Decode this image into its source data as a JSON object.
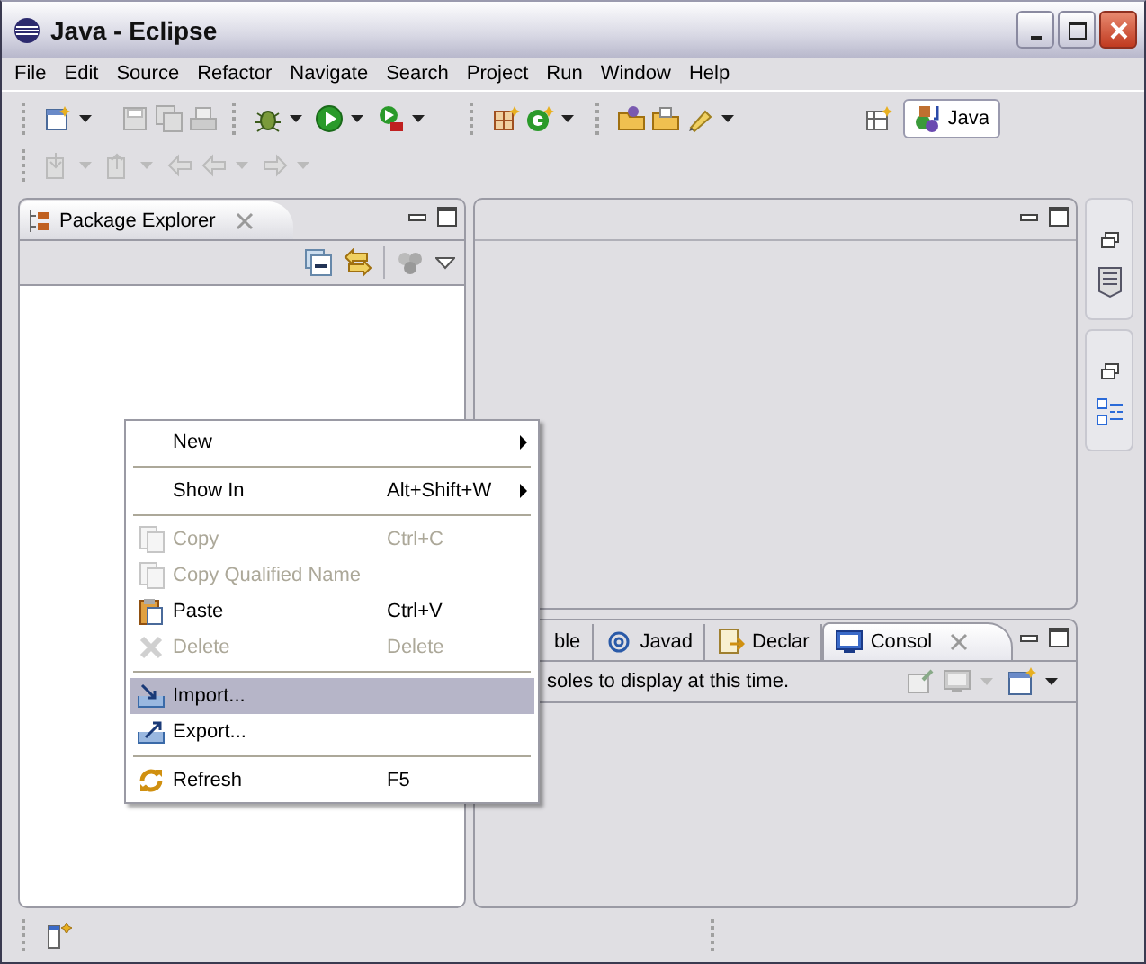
{
  "window": {
    "title": "Java - Eclipse"
  },
  "menu_bar": [
    "File",
    "Edit",
    "Source",
    "Refactor",
    "Navigate",
    "Search",
    "Project",
    "Run",
    "Window",
    "Help"
  ],
  "perspective": {
    "label": "Java",
    "selected": true
  },
  "package_explorer": {
    "title": "Package Explorer"
  },
  "context_menu": [
    {
      "kind": "item",
      "label": "New",
      "submenu": true,
      "disabled": false,
      "selected": false
    },
    {
      "kind": "separator"
    },
    {
      "kind": "item",
      "label": "Show In",
      "shortcut": "Alt+Shift+W",
      "submenu": true,
      "disabled": false,
      "selected": false
    },
    {
      "kind": "separator"
    },
    {
      "kind": "item",
      "label": "Copy",
      "shortcut": "Ctrl+C",
      "submenu": false,
      "disabled": true,
      "selected": false
    },
    {
      "kind": "item",
      "label": "Copy Qualified Name",
      "submenu": false,
      "disabled": true,
      "selected": false
    },
    {
      "kind": "item",
      "label": "Paste",
      "shortcut": "Ctrl+V",
      "submenu": false,
      "disabled": false,
      "selected": false
    },
    {
      "kind": "item",
      "label": "Delete",
      "shortcut": "Delete",
      "submenu": false,
      "disabled": true,
      "selected": false
    },
    {
      "kind": "separator"
    },
    {
      "kind": "item",
      "label": "Import...",
      "submenu": false,
      "disabled": false,
      "selected": true
    },
    {
      "kind": "item",
      "label": "Export...",
      "submenu": false,
      "disabled": false,
      "selected": false
    },
    {
      "kind": "separator"
    },
    {
      "kind": "item",
      "label": "Refresh",
      "shortcut": "F5",
      "submenu": false,
      "disabled": false,
      "selected": false
    }
  ],
  "bottom_panel": {
    "tabs": [
      {
        "label": "ble",
        "selected": false
      },
      {
        "label": "Javad",
        "selected": false
      },
      {
        "label": "Declar",
        "selected": false
      },
      {
        "label": "Consol",
        "selected": true
      }
    ],
    "message": "soles to display at this time."
  }
}
